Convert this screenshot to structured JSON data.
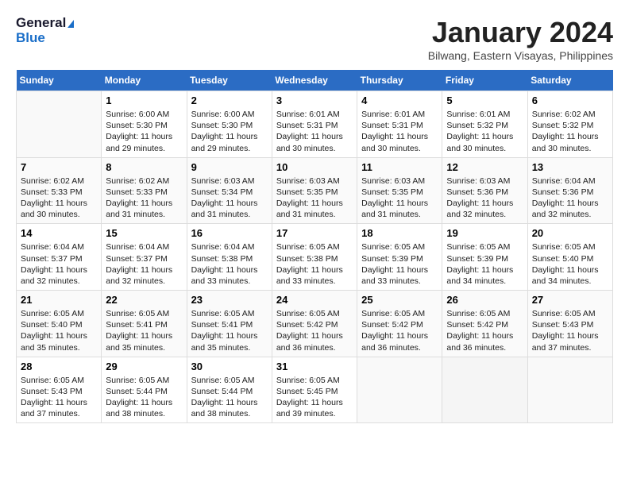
{
  "header": {
    "logo_line1": "General",
    "logo_line2": "Blue",
    "month": "January 2024",
    "location": "Bilwang, Eastern Visayas, Philippines"
  },
  "days_of_week": [
    "Sunday",
    "Monday",
    "Tuesday",
    "Wednesday",
    "Thursday",
    "Friday",
    "Saturday"
  ],
  "weeks": [
    [
      {
        "day": "",
        "sunrise": "",
        "sunset": "",
        "daylight": ""
      },
      {
        "day": "1",
        "sunrise": "Sunrise: 6:00 AM",
        "sunset": "Sunset: 5:30 PM",
        "daylight": "Daylight: 11 hours and 29 minutes."
      },
      {
        "day": "2",
        "sunrise": "Sunrise: 6:00 AM",
        "sunset": "Sunset: 5:30 PM",
        "daylight": "Daylight: 11 hours and 29 minutes."
      },
      {
        "day": "3",
        "sunrise": "Sunrise: 6:01 AM",
        "sunset": "Sunset: 5:31 PM",
        "daylight": "Daylight: 11 hours and 30 minutes."
      },
      {
        "day": "4",
        "sunrise": "Sunrise: 6:01 AM",
        "sunset": "Sunset: 5:31 PM",
        "daylight": "Daylight: 11 hours and 30 minutes."
      },
      {
        "day": "5",
        "sunrise": "Sunrise: 6:01 AM",
        "sunset": "Sunset: 5:32 PM",
        "daylight": "Daylight: 11 hours and 30 minutes."
      },
      {
        "day": "6",
        "sunrise": "Sunrise: 6:02 AM",
        "sunset": "Sunset: 5:32 PM",
        "daylight": "Daylight: 11 hours and 30 minutes."
      }
    ],
    [
      {
        "day": "7",
        "sunrise": "Sunrise: 6:02 AM",
        "sunset": "Sunset: 5:33 PM",
        "daylight": "Daylight: 11 hours and 30 minutes."
      },
      {
        "day": "8",
        "sunrise": "Sunrise: 6:02 AM",
        "sunset": "Sunset: 5:33 PM",
        "daylight": "Daylight: 11 hours and 31 minutes."
      },
      {
        "day": "9",
        "sunrise": "Sunrise: 6:03 AM",
        "sunset": "Sunset: 5:34 PM",
        "daylight": "Daylight: 11 hours and 31 minutes."
      },
      {
        "day": "10",
        "sunrise": "Sunrise: 6:03 AM",
        "sunset": "Sunset: 5:35 PM",
        "daylight": "Daylight: 11 hours and 31 minutes."
      },
      {
        "day": "11",
        "sunrise": "Sunrise: 6:03 AM",
        "sunset": "Sunset: 5:35 PM",
        "daylight": "Daylight: 11 hours and 31 minutes."
      },
      {
        "day": "12",
        "sunrise": "Sunrise: 6:03 AM",
        "sunset": "Sunset: 5:36 PM",
        "daylight": "Daylight: 11 hours and 32 minutes."
      },
      {
        "day": "13",
        "sunrise": "Sunrise: 6:04 AM",
        "sunset": "Sunset: 5:36 PM",
        "daylight": "Daylight: 11 hours and 32 minutes."
      }
    ],
    [
      {
        "day": "14",
        "sunrise": "Sunrise: 6:04 AM",
        "sunset": "Sunset: 5:37 PM",
        "daylight": "Daylight: 11 hours and 32 minutes."
      },
      {
        "day": "15",
        "sunrise": "Sunrise: 6:04 AM",
        "sunset": "Sunset: 5:37 PM",
        "daylight": "Daylight: 11 hours and 32 minutes."
      },
      {
        "day": "16",
        "sunrise": "Sunrise: 6:04 AM",
        "sunset": "Sunset: 5:38 PM",
        "daylight": "Daylight: 11 hours and 33 minutes."
      },
      {
        "day": "17",
        "sunrise": "Sunrise: 6:05 AM",
        "sunset": "Sunset: 5:38 PM",
        "daylight": "Daylight: 11 hours and 33 minutes."
      },
      {
        "day": "18",
        "sunrise": "Sunrise: 6:05 AM",
        "sunset": "Sunset: 5:39 PM",
        "daylight": "Daylight: 11 hours and 33 minutes."
      },
      {
        "day": "19",
        "sunrise": "Sunrise: 6:05 AM",
        "sunset": "Sunset: 5:39 PM",
        "daylight": "Daylight: 11 hours and 34 minutes."
      },
      {
        "day": "20",
        "sunrise": "Sunrise: 6:05 AM",
        "sunset": "Sunset: 5:40 PM",
        "daylight": "Daylight: 11 hours and 34 minutes."
      }
    ],
    [
      {
        "day": "21",
        "sunrise": "Sunrise: 6:05 AM",
        "sunset": "Sunset: 5:40 PM",
        "daylight": "Daylight: 11 hours and 35 minutes."
      },
      {
        "day": "22",
        "sunrise": "Sunrise: 6:05 AM",
        "sunset": "Sunset: 5:41 PM",
        "daylight": "Daylight: 11 hours and 35 minutes."
      },
      {
        "day": "23",
        "sunrise": "Sunrise: 6:05 AM",
        "sunset": "Sunset: 5:41 PM",
        "daylight": "Daylight: 11 hours and 35 minutes."
      },
      {
        "day": "24",
        "sunrise": "Sunrise: 6:05 AM",
        "sunset": "Sunset: 5:42 PM",
        "daylight": "Daylight: 11 hours and 36 minutes."
      },
      {
        "day": "25",
        "sunrise": "Sunrise: 6:05 AM",
        "sunset": "Sunset: 5:42 PM",
        "daylight": "Daylight: 11 hours and 36 minutes."
      },
      {
        "day": "26",
        "sunrise": "Sunrise: 6:05 AM",
        "sunset": "Sunset: 5:42 PM",
        "daylight": "Daylight: 11 hours and 36 minutes."
      },
      {
        "day": "27",
        "sunrise": "Sunrise: 6:05 AM",
        "sunset": "Sunset: 5:43 PM",
        "daylight": "Daylight: 11 hours and 37 minutes."
      }
    ],
    [
      {
        "day": "28",
        "sunrise": "Sunrise: 6:05 AM",
        "sunset": "Sunset: 5:43 PM",
        "daylight": "Daylight: 11 hours and 37 minutes."
      },
      {
        "day": "29",
        "sunrise": "Sunrise: 6:05 AM",
        "sunset": "Sunset: 5:44 PM",
        "daylight": "Daylight: 11 hours and 38 minutes."
      },
      {
        "day": "30",
        "sunrise": "Sunrise: 6:05 AM",
        "sunset": "Sunset: 5:44 PM",
        "daylight": "Daylight: 11 hours and 38 minutes."
      },
      {
        "day": "31",
        "sunrise": "Sunrise: 6:05 AM",
        "sunset": "Sunset: 5:45 PM",
        "daylight": "Daylight: 11 hours and 39 minutes."
      },
      {
        "day": "",
        "sunrise": "",
        "sunset": "",
        "daylight": ""
      },
      {
        "day": "",
        "sunrise": "",
        "sunset": "",
        "daylight": ""
      },
      {
        "day": "",
        "sunrise": "",
        "sunset": "",
        "daylight": ""
      }
    ]
  ]
}
